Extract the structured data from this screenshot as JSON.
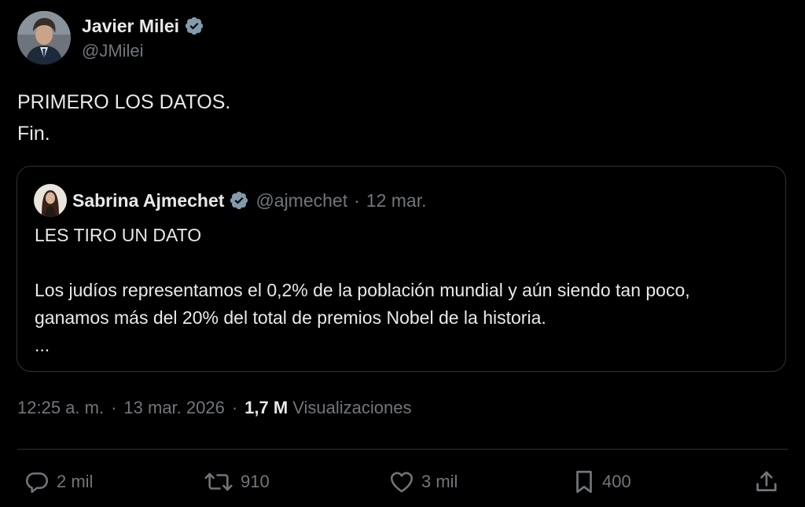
{
  "author": {
    "name": "Javier Milei",
    "handle": "@JMilei",
    "verified_icon": "verified-badge-icon"
  },
  "tweet": {
    "lines": [
      "PRIMERO LOS DATOS.",
      "Fin."
    ]
  },
  "quote": {
    "name": "Sabrina Ajmechet",
    "handle": "@ajmechet",
    "separator": "·",
    "date": "12 mar.",
    "line1": "LES TIRO UN DATO",
    "line2": "Los judíos representamos el 0,2% de la población mundial y aún siendo tan poco, ganamos más del 20% del total de premios Nobel de la historia.",
    "ellipsis": "..."
  },
  "meta": {
    "time": "12:25 a. m.",
    "sep1": "·",
    "date": "13 mar. 2026",
    "sep2": "·",
    "views_count": "1,7 M",
    "views_label": "Visualizaciones"
  },
  "actions": {
    "replies": "2 mil",
    "reposts": "910",
    "likes": "3 mil",
    "bookmarks": "400"
  },
  "colors": {
    "background": "#000000",
    "text": "#e7e9ea",
    "muted": "#71767b",
    "border": "#2f3336",
    "verified": "#829aab"
  }
}
